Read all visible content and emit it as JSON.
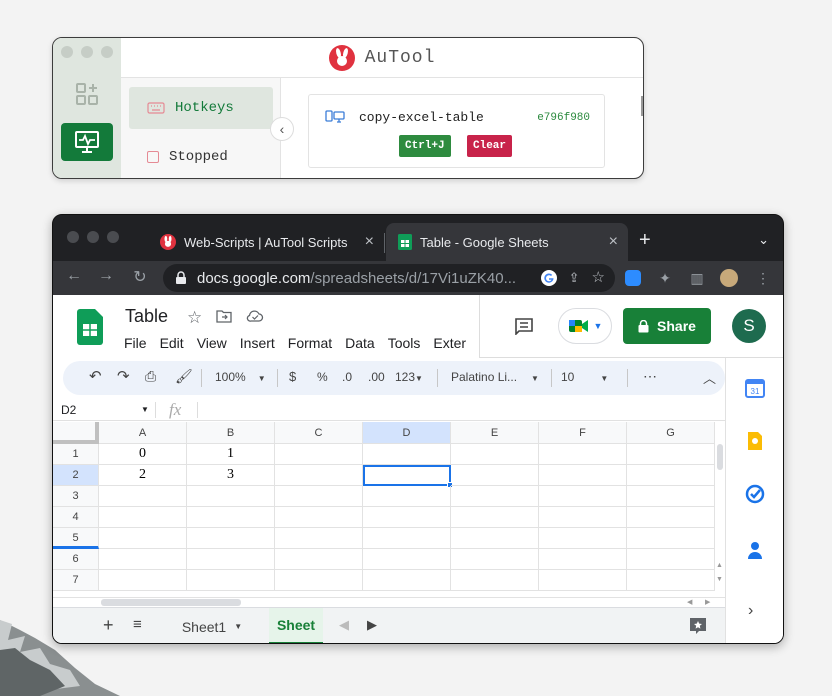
{
  "autool": {
    "title": "AuTool",
    "nav": {
      "hotkeys": "Hotkeys",
      "stopped": "Stopped"
    },
    "card": {
      "name": "copy-excel-table",
      "hash": "e796f980",
      "shortcut": "Ctrl+J",
      "clear_label": "Clear"
    },
    "colors": {
      "accent": "#137a3a",
      "clear": "#c8234a",
      "logo": "#e0323f"
    }
  },
  "browser": {
    "tabs": [
      {
        "title": "Web-Scripts | AuTool Scripts",
        "icon": "autool-rabbit-icon"
      },
      {
        "title": "Table - Google Sheets",
        "icon": "sheets-icon",
        "active": true
      }
    ],
    "url": {
      "host": "docs.google.com",
      "path": "/spreadsheets/d/17Vi1uZK40..."
    }
  },
  "sheets": {
    "doc_title": "Table",
    "menu": [
      "File",
      "Edit",
      "View",
      "Insert",
      "Format",
      "Data",
      "Tools",
      "Exter"
    ],
    "share_label": "Share",
    "avatar_initial": "S",
    "toolbar": {
      "zoom": "100%",
      "currency": "$",
      "percent": "%",
      "dec_decrease": ".0",
      "dec_increase": ".00",
      "number_format": "123",
      "font": "Palatino Li...",
      "font_size": "10",
      "more": "⋯"
    },
    "name_box": "D2",
    "fx": "fx",
    "columns": [
      "A",
      "B",
      "C",
      "D",
      "E",
      "F",
      "G"
    ],
    "rows": [
      "1",
      "2",
      "3",
      "4",
      "5",
      "6",
      "7"
    ],
    "cells": [
      [
        "0",
        "1"
      ],
      [
        "2",
        "3"
      ]
    ],
    "selected_cell": "D2",
    "sheet_tabs": [
      "Sheet1",
      "Sheet"
    ],
    "colors": {
      "brand": "#188038",
      "selection": "#1a73e8"
    }
  }
}
